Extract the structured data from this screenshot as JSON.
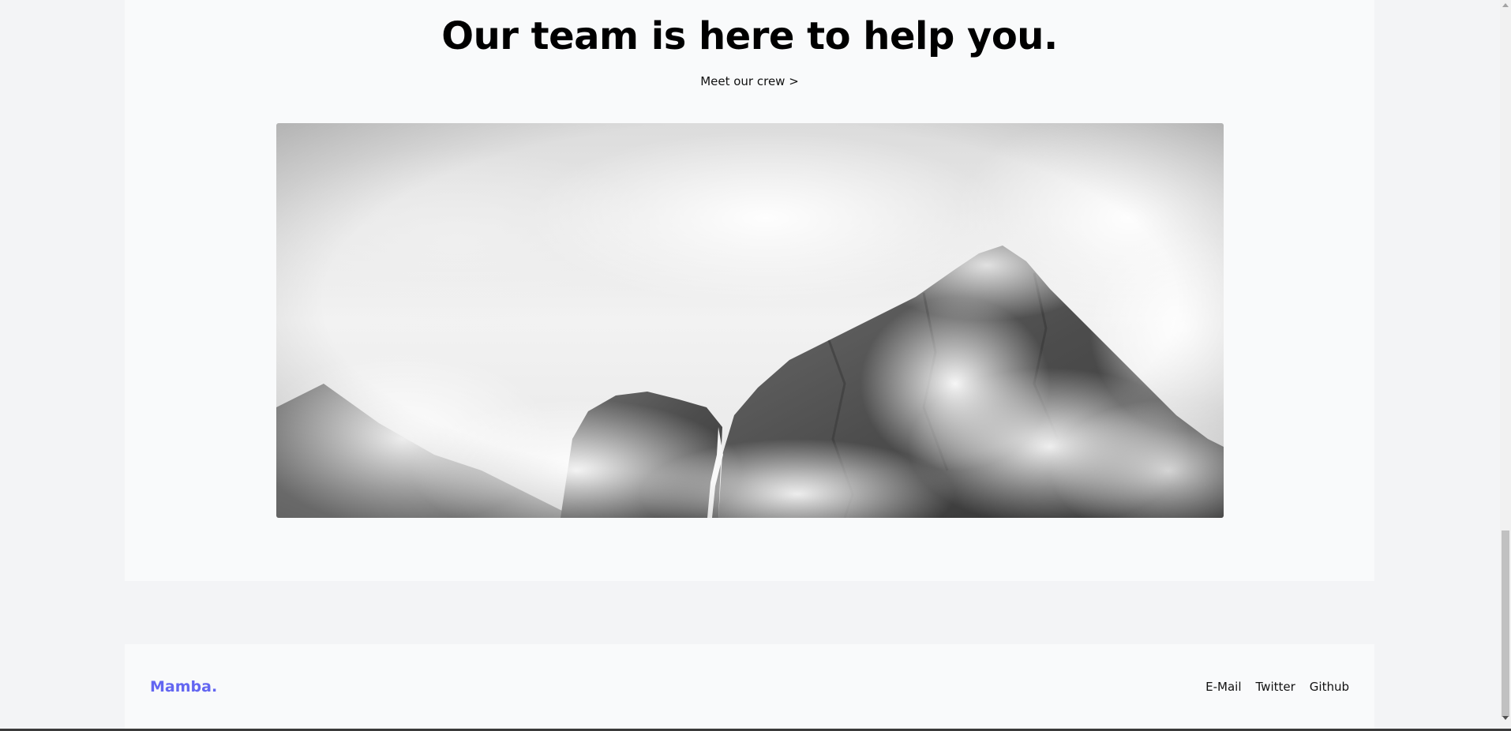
{
  "hero": {
    "title": "Our team is here to help you.",
    "link_label": "Meet our crew >",
    "image_alt": "Misty mountain cliffs with a waterfall"
  },
  "footer": {
    "brand": "Mamba.",
    "links": [
      "E-Mail",
      "Twitter",
      "Github"
    ]
  },
  "colors": {
    "brand": "#6366f1",
    "section_bg": "#f9fafb",
    "page_bg": "#f3f4f6"
  }
}
